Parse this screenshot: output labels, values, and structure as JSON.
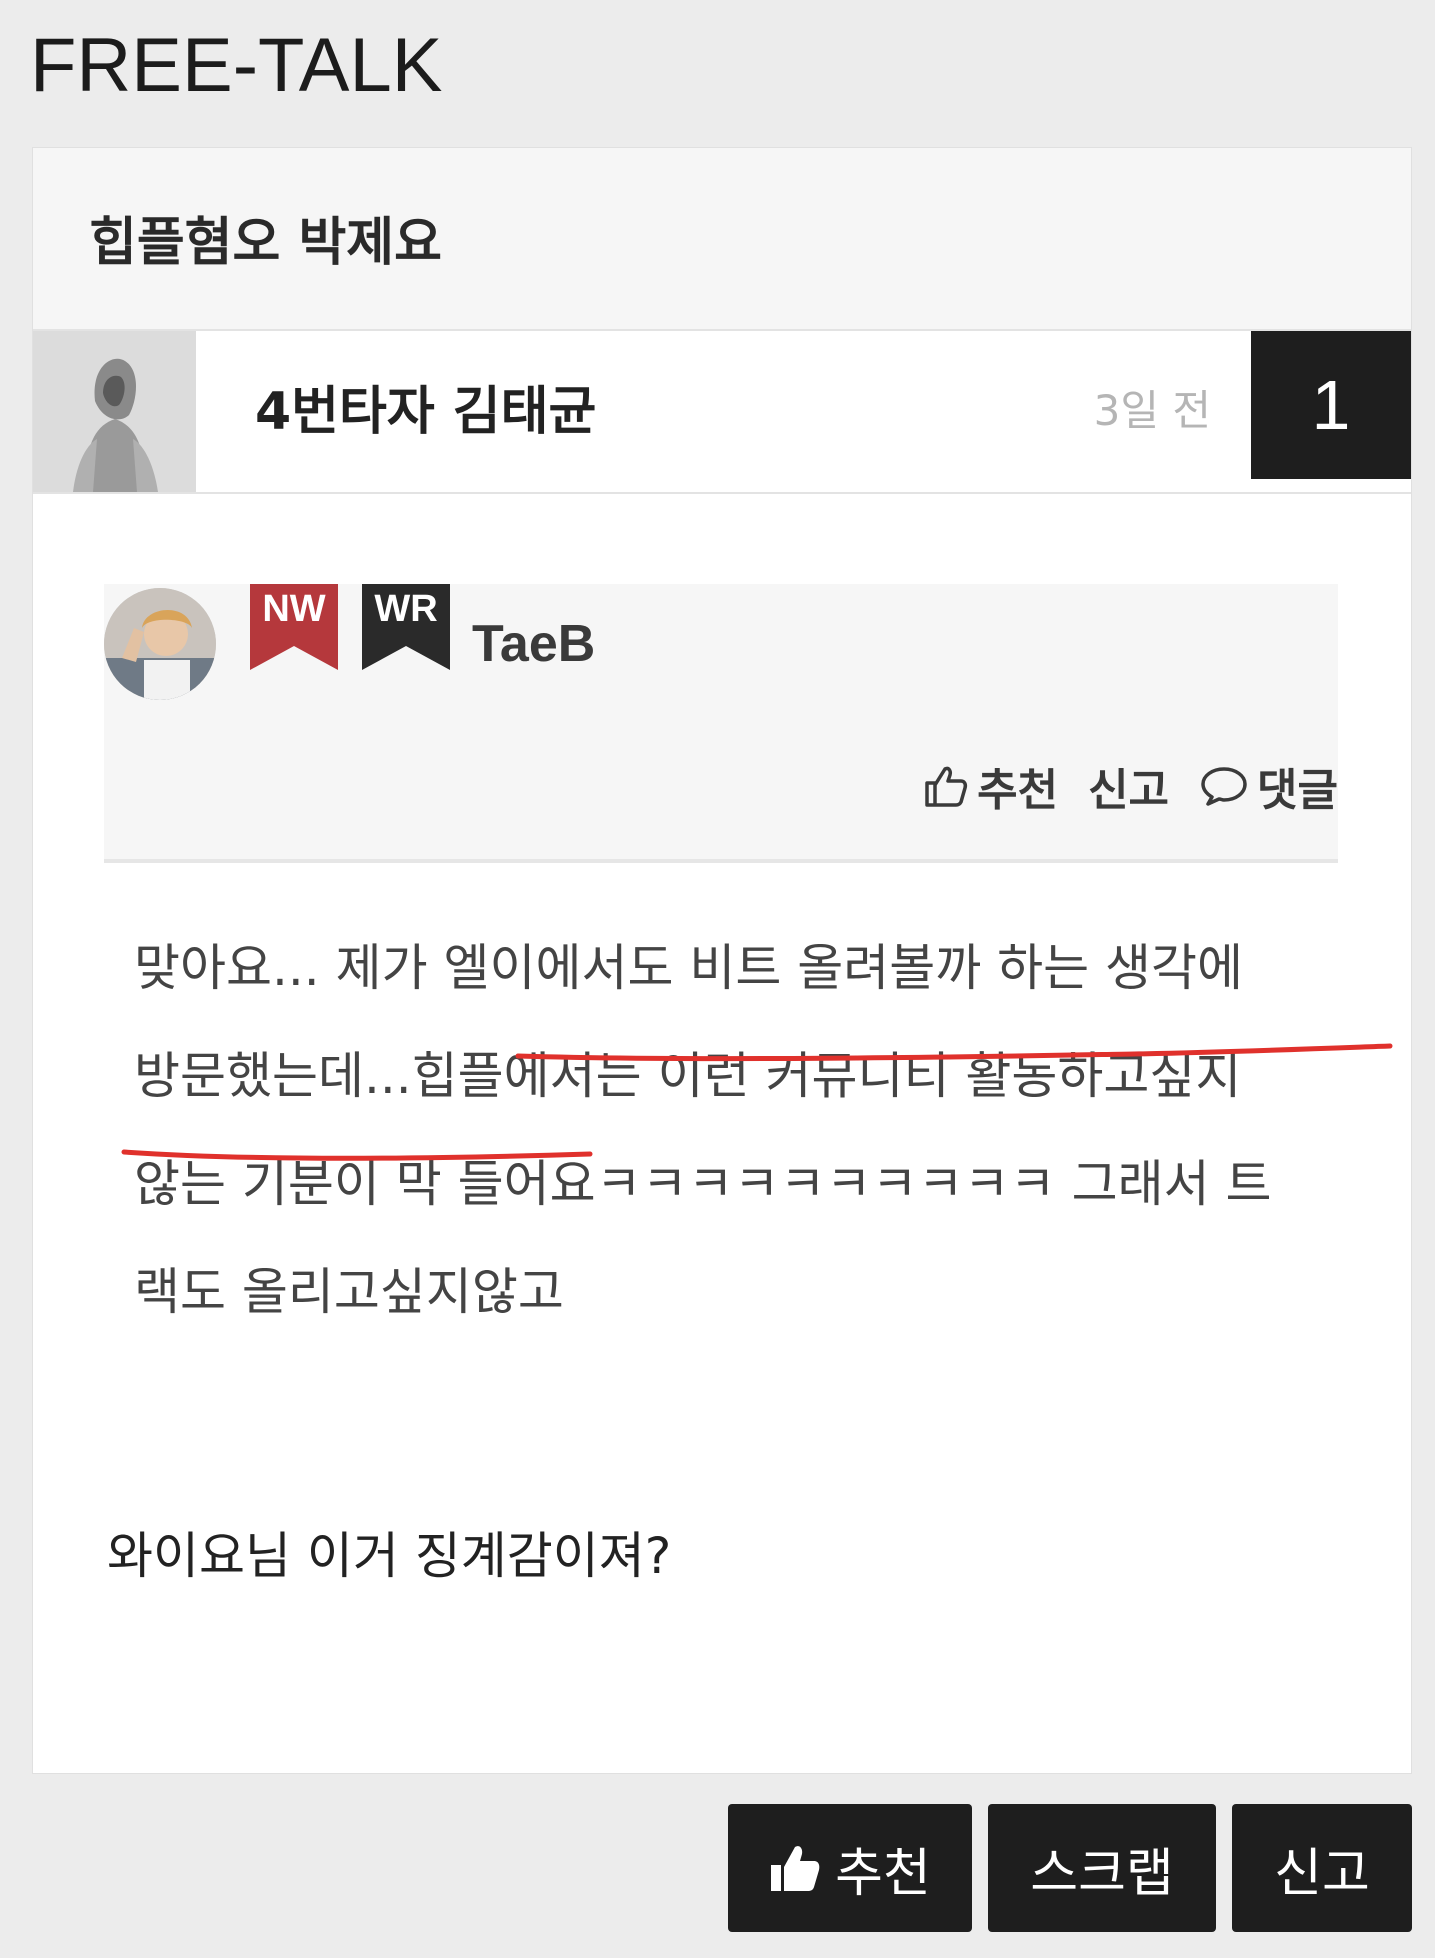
{
  "board": {
    "title": "FREE-TALK"
  },
  "post": {
    "title": "힙플혐오 박제요",
    "author": "4번타자 김태균",
    "time": "3일 전",
    "comment_count": "1",
    "body": "와이요님 이거 징계감이져?"
  },
  "embed": {
    "badges": [
      "NW",
      "WR"
    ],
    "badge_colors": [
      "#b5383c",
      "#2a2a2a"
    ],
    "username": "TaeB",
    "actions": {
      "recommend": "추천",
      "report": "신고",
      "comment": "댓글"
    },
    "lines": [
      "맞아요... 제가 엘이에서도 비트 올려볼까 하는 생각에",
      "방문했는데...힙플에서는 이런 커뮤니티 활동하고싶지",
      "않는 기분이 막 들어요ㅋㅋㅋㅋㅋㅋㅋㅋㅋㅋ 그래서 트",
      "랙도 올리고싶지않고"
    ],
    "underline_color": "#e0312c"
  },
  "buttons": {
    "recommend": "추천",
    "scrap": "스크랩",
    "report": "신고"
  }
}
